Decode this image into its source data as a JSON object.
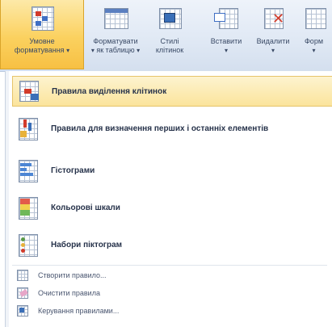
{
  "ribbon": {
    "buttons": [
      {
        "line1": "Умовне",
        "line2": "форматування",
        "icon": "conditional-formatting-icon",
        "active": true
      },
      {
        "line1": "Форматувати",
        "line2": "як таблицю",
        "icon": "format-as-table-icon",
        "active": false
      },
      {
        "line1": "Стилі",
        "line2": "клітинок",
        "icon": "cell-styles-icon",
        "active": false
      },
      {
        "line1": "Вставити",
        "line2": "",
        "icon": "insert-cells-icon",
        "active": false
      },
      {
        "line1": "Видалити",
        "line2": "",
        "icon": "delete-cells-icon",
        "active": false
      },
      {
        "line1": "Форм",
        "line2": "",
        "icon": "format-cells-icon",
        "active": false
      }
    ]
  },
  "menu": {
    "items": [
      {
        "label": "Правила виділення клітинок",
        "icon": "highlight-cells-rules-icon",
        "highlighted": true
      },
      {
        "label": "Правила для визначення перших і останніх елементів",
        "icon": "top-bottom-rules-icon",
        "highlighted": false
      },
      {
        "label": "Гістограми",
        "icon": "data-bars-icon",
        "highlighted": false
      },
      {
        "label": "Кольорові шкали",
        "icon": "color-scales-icon",
        "highlighted": false
      },
      {
        "label": "Набори піктограм",
        "icon": "icon-sets-icon",
        "highlighted": false
      }
    ],
    "small_items": [
      {
        "label": "Створити правило...",
        "icon": "new-rule-icon"
      },
      {
        "label": "Очистити правила",
        "icon": "clear-rules-icon"
      },
      {
        "label": "Керування правилами...",
        "icon": "manage-rules-icon"
      }
    ]
  },
  "colors": {
    "active_button": "#fbd15f",
    "highlight_item": "#fbe49c",
    "ribbon_bg": "#dfe8f4"
  }
}
